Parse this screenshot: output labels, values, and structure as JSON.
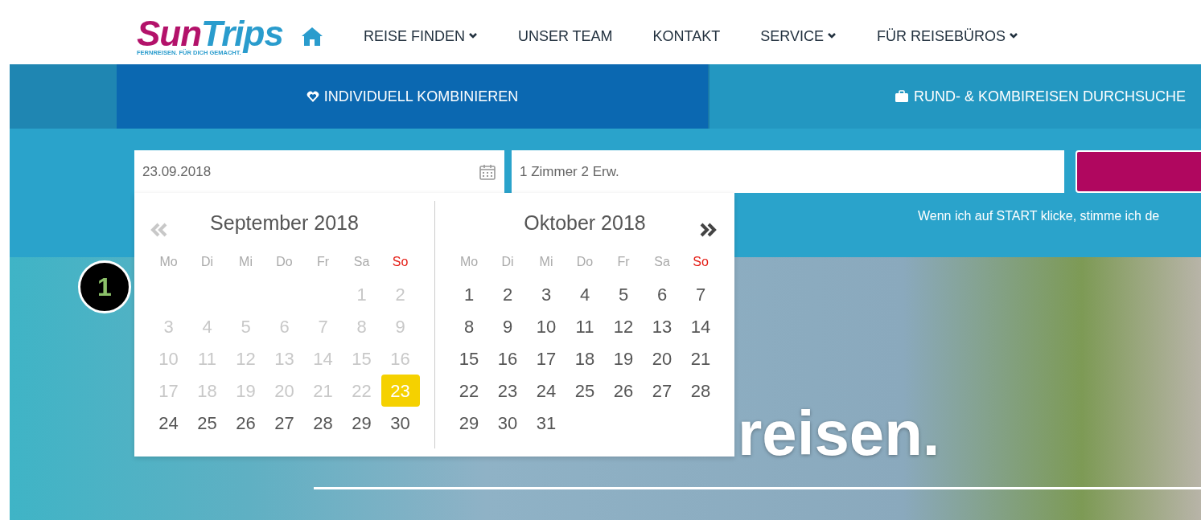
{
  "header": {
    "logo": {
      "brand_part_1": "Sun",
      "brand_part_2": "Trips",
      "tagline": "FERNREISEN. FÜR DICH GEMACHT."
    },
    "nav": [
      {
        "label": "REISE FINDEN",
        "dropdown": true
      },
      {
        "label": "UNSER TEAM",
        "dropdown": false
      },
      {
        "label": "KONTAKT",
        "dropdown": false
      },
      {
        "label": "SERVICE",
        "dropdown": true
      },
      {
        "label": "FÜR REISEBÜROS",
        "dropdown": true
      }
    ]
  },
  "tabs": [
    {
      "label": "INDIVIDUELL KOMBINIEREN",
      "selected": true
    },
    {
      "label": "RUND- & KOMBIREISEN DURCHSUCHE",
      "selected": false
    }
  ],
  "search": {
    "date_value": "23.09.2018",
    "guests_value": "1 Zimmer 2 Erw.",
    "consent_text": "Wenn ich auf START klicke, stimme ich de"
  },
  "datepicker": {
    "prev": {
      "disabled": true
    },
    "next": {
      "disabled": false
    },
    "months": [
      {
        "title": "September 2018",
        "weekdays": [
          {
            "label": "Mo",
            "color": "#aaaaaa"
          },
          {
            "label": "Di",
            "color": "#aaaaaa"
          },
          {
            "label": "Mi",
            "color": "#aaaaaa"
          },
          {
            "label": "Do",
            "color": "#aaaaaa"
          },
          {
            "label": "Fr",
            "color": "#aaaaaa"
          },
          {
            "label": "Sa",
            "color": "#aaaaaa"
          },
          {
            "label": "So",
            "color": "#e41b13"
          }
        ],
        "weeks": [
          [
            {
              "label": "1",
              "disabled": true,
              "selected": false
            },
            {
              "label": "2",
              "disabled": true,
              "selected": false
            }
          ],
          [
            {
              "label": "3",
              "disabled": true,
              "selected": false
            },
            {
              "label": "4",
              "disabled": true,
              "selected": false
            },
            {
              "label": "5",
              "disabled": true,
              "selected": false
            },
            {
              "label": "6",
              "disabled": true,
              "selected": false
            },
            {
              "label": "7",
              "disabled": true,
              "selected": false
            },
            {
              "label": "8",
              "disabled": true,
              "selected": false
            },
            {
              "label": "9",
              "disabled": true,
              "selected": false
            }
          ],
          [
            {
              "label": "10",
              "disabled": true,
              "selected": false
            },
            {
              "label": "11",
              "disabled": true,
              "selected": false
            },
            {
              "label": "12",
              "disabled": true,
              "selected": false
            },
            {
              "label": "13",
              "disabled": true,
              "selected": false
            },
            {
              "label": "14",
              "disabled": true,
              "selected": false
            },
            {
              "label": "15",
              "disabled": true,
              "selected": false
            },
            {
              "label": "16",
              "disabled": true,
              "selected": false
            }
          ],
          [
            {
              "label": "17",
              "disabled": true,
              "selected": false
            },
            {
              "label": "18",
              "disabled": true,
              "selected": false
            },
            {
              "label": "19",
              "disabled": true,
              "selected": false
            },
            {
              "label": "20",
              "disabled": true,
              "selected": false
            },
            {
              "label": "21",
              "disabled": true,
              "selected": false
            },
            {
              "label": "22",
              "disabled": true,
              "selected": false
            },
            {
              "label": "23",
              "disabled": false,
              "selected": true
            }
          ],
          [
            {
              "label": "24",
              "disabled": false,
              "selected": false
            },
            {
              "label": "25",
              "disabled": false,
              "selected": false
            },
            {
              "label": "26",
              "disabled": false,
              "selected": false
            },
            {
              "label": "27",
              "disabled": false,
              "selected": false
            },
            {
              "label": "28",
              "disabled": false,
              "selected": false
            },
            {
              "label": "29",
              "disabled": false,
              "selected": false
            },
            {
              "label": "30",
              "disabled": false,
              "selected": false
            }
          ]
        ]
      },
      {
        "title": "Oktober 2018",
        "weekdays": [
          {
            "label": "Mo",
            "color": "#aaaaaa"
          },
          {
            "label": "Di",
            "color": "#aaaaaa"
          },
          {
            "label": "Mi",
            "color": "#aaaaaa"
          },
          {
            "label": "Do",
            "color": "#aaaaaa"
          },
          {
            "label": "Fr",
            "color": "#aaaaaa"
          },
          {
            "label": "Sa",
            "color": "#aaaaaa"
          },
          {
            "label": "So",
            "color": "#e41b13"
          }
        ],
        "weeks": [
          [
            {
              "label": "1",
              "disabled": false,
              "selected": false
            },
            {
              "label": "2",
              "disabled": false,
              "selected": false
            },
            {
              "label": "3",
              "disabled": false,
              "selected": false
            },
            {
              "label": "4",
              "disabled": false,
              "selected": false
            },
            {
              "label": "5",
              "disabled": false,
              "selected": false
            },
            {
              "label": "6",
              "disabled": false,
              "selected": false
            },
            {
              "label": "7",
              "disabled": false,
              "selected": false
            }
          ],
          [
            {
              "label": "8",
              "disabled": false,
              "selected": false
            },
            {
              "label": "9",
              "disabled": false,
              "selected": false
            },
            {
              "label": "10",
              "disabled": false,
              "selected": false
            },
            {
              "label": "11",
              "disabled": false,
              "selected": false
            },
            {
              "label": "12",
              "disabled": false,
              "selected": false
            },
            {
              "label": "13",
              "disabled": false,
              "selected": false
            },
            {
              "label": "14",
              "disabled": false,
              "selected": false
            }
          ],
          [
            {
              "label": "15",
              "disabled": false,
              "selected": false
            },
            {
              "label": "16",
              "disabled": false,
              "selected": false
            },
            {
              "label": "17",
              "disabled": false,
              "selected": false
            },
            {
              "label": "18",
              "disabled": false,
              "selected": false
            },
            {
              "label": "19",
              "disabled": false,
              "selected": false
            },
            {
              "label": "20",
              "disabled": false,
              "selected": false
            },
            {
              "label": "21",
              "disabled": false,
              "selected": false
            }
          ],
          [
            {
              "label": "22",
              "disabled": false,
              "selected": false
            },
            {
              "label": "23",
              "disabled": false,
              "selected": false
            },
            {
              "label": "24",
              "disabled": false,
              "selected": false
            },
            {
              "label": "25",
              "disabled": false,
              "selected": false
            },
            {
              "label": "26",
              "disabled": false,
              "selected": false
            },
            {
              "label": "27",
              "disabled": false,
              "selected": false
            },
            {
              "label": "28",
              "disabled": false,
              "selected": false
            }
          ],
          [
            {
              "label": "29",
              "disabled": false,
              "selected": false
            },
            {
              "label": "30",
              "disabled": false,
              "selected": false
            },
            {
              "label": "31",
              "disabled": false,
              "selected": false
            }
          ]
        ]
      }
    ]
  },
  "hero": {
    "headline": "reisen."
  },
  "step_marker": "1"
}
